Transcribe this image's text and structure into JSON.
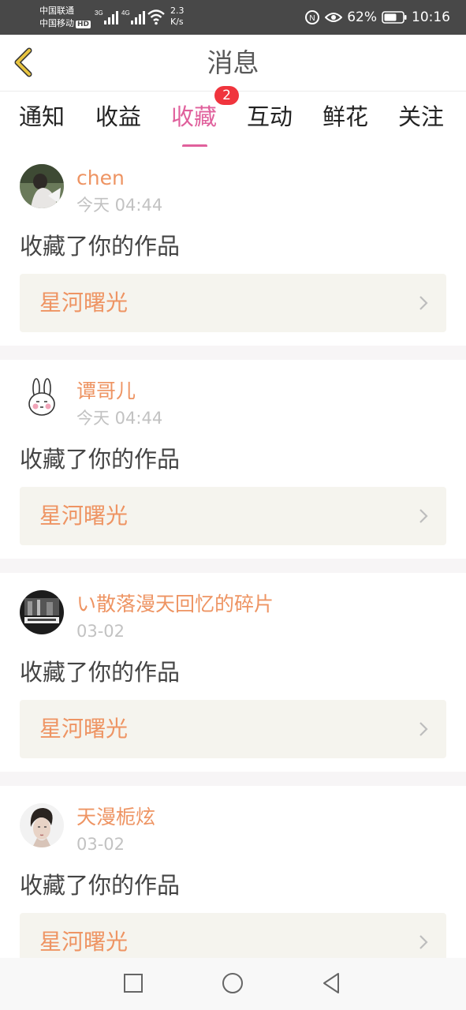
{
  "status_bar": {
    "carrier_1": "中国联通",
    "carrier_2": "中国移动",
    "hd_badge": "HD",
    "signal_1_label": "3G",
    "signal_2_label": "4G",
    "net_speed_value": "2.3",
    "net_speed_unit": "K/s",
    "battery_percent": "62%",
    "time": "10:16",
    "icons": [
      "nfc-icon",
      "eye-icon",
      "wifi-icon",
      "battery-icon"
    ]
  },
  "header": {
    "title": "消息",
    "back_icon": "chevron-left-icon",
    "back_color": "#e8c440"
  },
  "tabs": {
    "items": [
      {
        "label": "通知"
      },
      {
        "label": "收益"
      },
      {
        "label": "收藏"
      },
      {
        "label": "互动"
      },
      {
        "label": "鲜花"
      },
      {
        "label": "关注"
      }
    ],
    "active_index": 2,
    "badge": "2",
    "active_color": "#e0609c",
    "badge_color": "#f0343d"
  },
  "notifications": [
    {
      "user": "chen",
      "time": "今天 04:44",
      "action": "收藏了你的作品",
      "work": "星河曙光"
    },
    {
      "user": "谭哥儿",
      "time": "今天 04:44",
      "action": "收藏了你的作品",
      "work": "星河曙光"
    },
    {
      "user": "い散落漫天回忆的碎片",
      "time": "03-02",
      "action": "收藏了你的作品",
      "work": "星河曙光"
    },
    {
      "user": "天漫栀炫",
      "time": "03-02",
      "action": "收藏了你的作品",
      "work": "星河曙光"
    }
  ],
  "colors": {
    "accent_orange": "#ee9463",
    "work_box_bg": "#f5f4ee",
    "status_bar_bg": "#484848"
  },
  "nav_bar": {
    "icons": [
      "square-icon",
      "circle-home-icon",
      "triangle-back-icon"
    ]
  }
}
